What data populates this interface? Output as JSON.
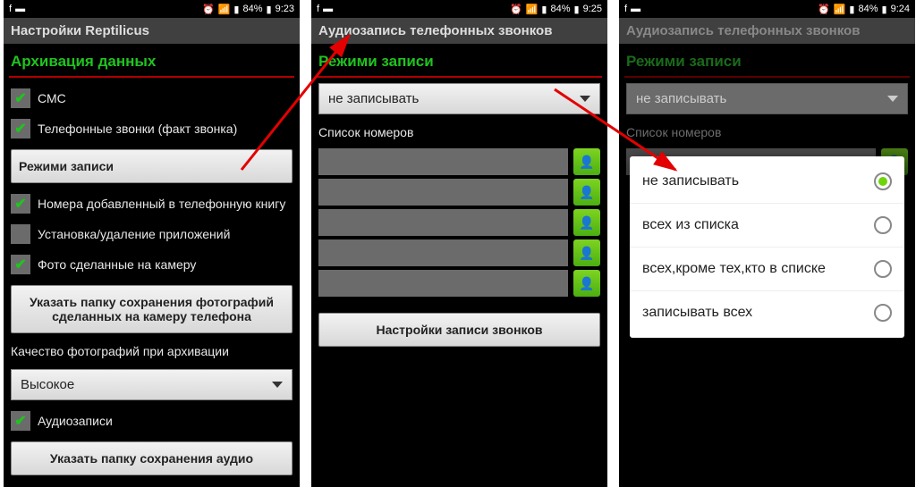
{
  "status": {
    "battery": "84%",
    "t1": "9:23",
    "t2": "9:25",
    "t3": "9:24"
  },
  "phone1": {
    "title": "Настройки Reptilicus",
    "section": "Архивация данных",
    "items": {
      "sms": "СМС",
      "calls": "Телефонные звонки (факт звонка)",
      "rec_modes": "Режими записи",
      "contacts_added": "Номера добавленный в телефонную книгу",
      "apps": "Установка/удаление приложений",
      "photos": "Фото сделанные на камеру",
      "photo_folder": "Указать папку сохранения фотографий сделанных на камеру телефона",
      "photo_quality_lbl": "Качество фотографий при архивации",
      "quality_value": "Высокое",
      "audio": "Аудиозаписи",
      "audio_folder": "Указать папку сохранения аудио"
    }
  },
  "phone2": {
    "title": "Аудиозапись телефонных звонков",
    "section": "Режими записи",
    "mode": "не записывать",
    "list_lbl": "Список номеров",
    "settings_btn": "Настройки записи звонков"
  },
  "phone3": {
    "title": "Аудиозапись телефонных звонков",
    "section": "Режими записи",
    "mode": "не записывать",
    "list_lbl": "Список номеров",
    "options": [
      "не записывать",
      "всех из списка",
      "всех,кроме тех,кто в списке",
      "записывать всех"
    ]
  }
}
